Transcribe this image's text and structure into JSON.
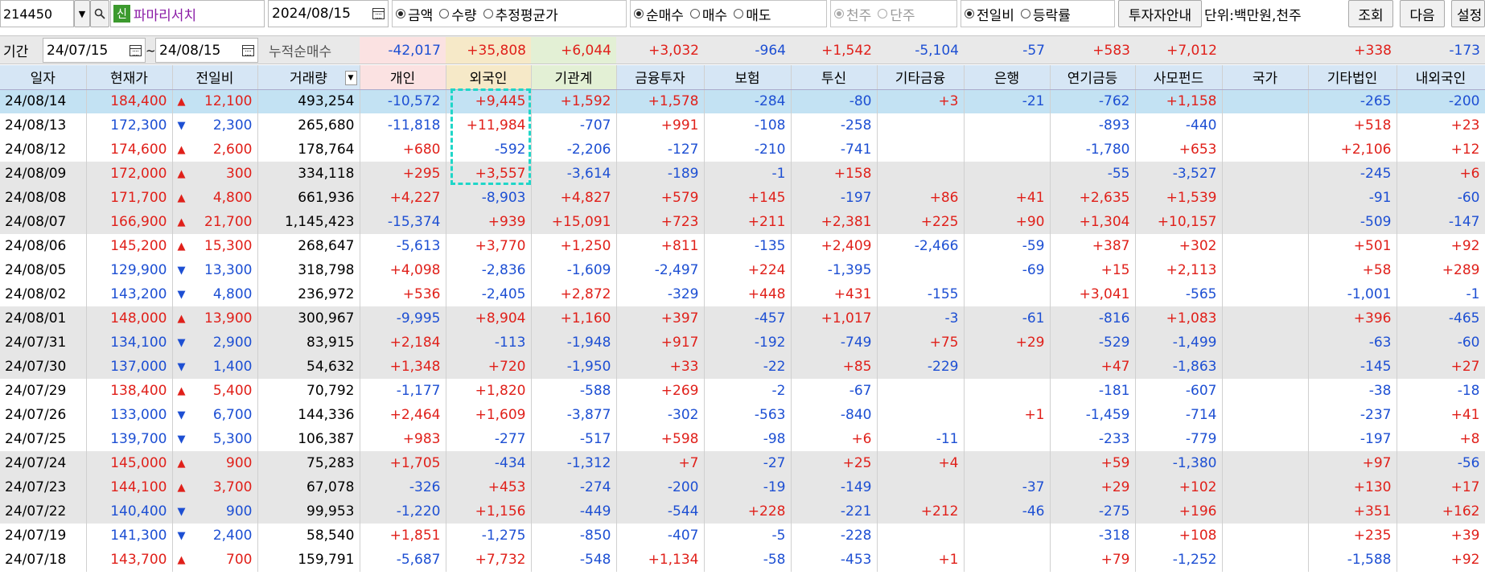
{
  "toolbar": {
    "code": "214450",
    "badge": "신",
    "stock_name": "파마리서치",
    "date": "2024/08/15",
    "mode_radios": [
      "금액",
      "수량",
      "추정평균가"
    ],
    "mode_selected": 0,
    "trade_radios": [
      "순매수",
      "매수",
      "매도"
    ],
    "trade_selected": 0,
    "unit_radios": [
      "천주",
      "단주"
    ],
    "unit_selected": 0,
    "cmp_radios": [
      "전일비",
      "등락률"
    ],
    "cmp_selected": 0,
    "investor_guide": "투자자안내",
    "unit_text": "단위:백만원,천주",
    "query": "조회",
    "next": "다음",
    "settings": "설정"
  },
  "period": {
    "label": "기간",
    "from": "24/07/15",
    "tilde": "~",
    "to": "24/08/15",
    "cum_label": "누적순매수"
  },
  "summary": [
    "-42,017",
    "+35,808",
    "+6,044",
    "+3,032",
    "-964",
    "+1,542",
    "-5,104",
    "-57",
    "+583",
    "+7,012",
    "",
    "+338",
    "-173"
  ],
  "headers": [
    "일자",
    "현재가",
    "전일비",
    "거래량",
    "개인",
    "외국인",
    "기관계",
    "금융투자",
    "보험",
    "투신",
    "기타금융",
    "은행",
    "연기금등",
    "사모펀드",
    "국가",
    "기타법인",
    "내외국인"
  ],
  "rows": [
    [
      "24/08/14",
      "184,400",
      "up",
      "12,100",
      "493,254",
      "-10,572",
      "+9,445",
      "+1,592",
      "+1,578",
      "-284",
      "-80",
      "+3",
      "-21",
      "-762",
      "+1,158",
      "",
      "-265",
      "-200"
    ],
    [
      "24/08/13",
      "172,300",
      "down",
      "2,300",
      "265,680",
      "-11,818",
      "+11,984",
      "-707",
      "+991",
      "-108",
      "-258",
      "",
      "",
      "-893",
      "-440",
      "",
      "+518",
      "+23"
    ],
    [
      "24/08/12",
      "174,600",
      "up",
      "2,600",
      "178,764",
      "+680",
      "-592",
      "-2,206",
      "-127",
      "-210",
      "-741",
      "",
      "",
      "-1,780",
      "+653",
      "",
      "+2,106",
      "+12"
    ],
    [
      "24/08/09",
      "172,000",
      "up",
      "300",
      "334,118",
      "+295",
      "+3,557",
      "-3,614",
      "-189",
      "-1",
      "+158",
      "",
      "",
      "-55",
      "-3,527",
      "",
      "-245",
      "+6"
    ],
    [
      "24/08/08",
      "171,700",
      "up",
      "4,800",
      "661,936",
      "+4,227",
      "-8,903",
      "+4,827",
      "+579",
      "+145",
      "-197",
      "+86",
      "+41",
      "+2,635",
      "+1,539",
      "",
      "-91",
      "-60"
    ],
    [
      "24/08/07",
      "166,900",
      "up",
      "21,700",
      "1,145,423",
      "-15,374",
      "+939",
      "+15,091",
      "+723",
      "+211",
      "+2,381",
      "+225",
      "+90",
      "+1,304",
      "+10,157",
      "",
      "-509",
      "-147"
    ],
    [
      "24/08/06",
      "145,200",
      "up",
      "15,300",
      "268,647",
      "-5,613",
      "+3,770",
      "+1,250",
      "+811",
      "-135",
      "+2,409",
      "-2,466",
      "-59",
      "+387",
      "+302",
      "",
      "+501",
      "+92"
    ],
    [
      "24/08/05",
      "129,900",
      "down",
      "13,300",
      "318,798",
      "+4,098",
      "-2,836",
      "-1,609",
      "-2,497",
      "+224",
      "-1,395",
      "",
      "-69",
      "+15",
      "+2,113",
      "",
      "+58",
      "+289"
    ],
    [
      "24/08/02",
      "143,200",
      "down",
      "4,800",
      "236,972",
      "+536",
      "-2,405",
      "+2,872",
      "-329",
      "+448",
      "+431",
      "-155",
      "",
      "+3,041",
      "-565",
      "",
      "-1,001",
      "-1"
    ],
    [
      "24/08/01",
      "148,000",
      "up",
      "13,900",
      "300,967",
      "-9,995",
      "+8,904",
      "+1,160",
      "+397",
      "-457",
      "+1,017",
      "-3",
      "-61",
      "-816",
      "+1,083",
      "",
      "+396",
      "-465"
    ],
    [
      "24/07/31",
      "134,100",
      "down",
      "2,900",
      "83,915",
      "+2,184",
      "-113",
      "-1,948",
      "+917",
      "-192",
      "-749",
      "+75",
      "+29",
      "-529",
      "-1,499",
      "",
      "-63",
      "-60"
    ],
    [
      "24/07/30",
      "137,000",
      "down",
      "1,400",
      "54,632",
      "+1,348",
      "+720",
      "-1,950",
      "+33",
      "-22",
      "+85",
      "-229",
      "",
      "+47",
      "-1,863",
      "",
      "-145",
      "+27"
    ],
    [
      "24/07/29",
      "138,400",
      "up",
      "5,400",
      "70,792",
      "-1,177",
      "+1,820",
      "-588",
      "+269",
      "-2",
      "-67",
      "",
      "",
      "-181",
      "-607",
      "",
      "-38",
      "-18"
    ],
    [
      "24/07/26",
      "133,000",
      "down",
      "6,700",
      "144,336",
      "+2,464",
      "+1,609",
      "-3,877",
      "-302",
      "-563",
      "-840",
      "",
      "+1",
      "-1,459",
      "-714",
      "",
      "-237",
      "+41"
    ],
    [
      "24/07/25",
      "139,700",
      "down",
      "5,300",
      "106,387",
      "+983",
      "-277",
      "-517",
      "+598",
      "-98",
      "+6",
      "-11",
      "",
      "-233",
      "-779",
      "",
      "-197",
      "+8"
    ],
    [
      "24/07/24",
      "145,000",
      "up",
      "900",
      "75,283",
      "+1,705",
      "-434",
      "-1,312",
      "+7",
      "-27",
      "+25",
      "+4",
      "",
      "+59",
      "-1,380",
      "",
      "+97",
      "-56"
    ],
    [
      "24/07/23",
      "144,100",
      "up",
      "3,700",
      "67,078",
      "-326",
      "+453",
      "-274",
      "-200",
      "-19",
      "-149",
      "",
      "-37",
      "+29",
      "+102",
      "",
      "+130",
      "+17"
    ],
    [
      "24/07/22",
      "140,400",
      "down",
      "900",
      "99,953",
      "-1,220",
      "+1,156",
      "-449",
      "-544",
      "+228",
      "-221",
      "+212",
      "-46",
      "-275",
      "+196",
      "",
      "+351",
      "+162"
    ],
    [
      "24/07/19",
      "141,300",
      "down",
      "2,400",
      "58,540",
      "+1,851",
      "-1,275",
      "-850",
      "-407",
      "-5",
      "-228",
      "",
      "",
      "-318",
      "+108",
      "",
      "+235",
      "+39"
    ],
    [
      "24/07/18",
      "143,700",
      "up",
      "700",
      "159,791",
      "-5,687",
      "+7,732",
      "-548",
      "+1,134",
      "-58",
      "-453",
      "+1",
      "",
      "+79",
      "-1,252",
      "",
      "-1,588",
      "+92"
    ]
  ],
  "row_bands": [
    "sel",
    "white",
    "white",
    "grey",
    "grey",
    "grey",
    "white",
    "white",
    "white",
    "grey",
    "grey",
    "grey",
    "white",
    "white",
    "white",
    "grey",
    "grey",
    "grey",
    "white",
    "white"
  ],
  "colors": {
    "up": "#e0201a",
    "down": "#1d4fd3",
    "header": "#d6e6f5",
    "selected": "#c3e2f3",
    "band": "#e6e6e6",
    "highlight": "#1fd6c8"
  },
  "icons": {
    "dropdown": "chevron-down-icon",
    "search": "search-icon",
    "calendar": "calendar-icon",
    "sort": "sort-triangle-icon"
  }
}
